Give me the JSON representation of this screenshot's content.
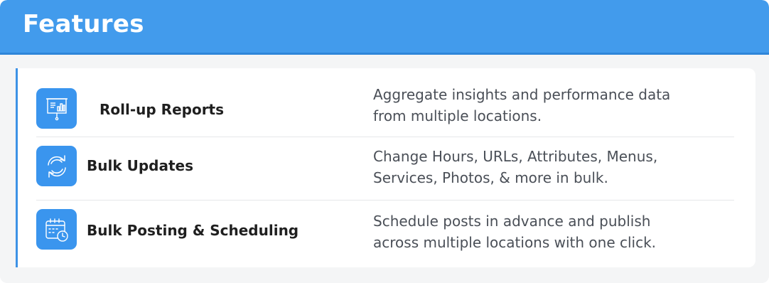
{
  "header": {
    "title": "Features"
  },
  "features": [
    {
      "icon": "presentation-chart-icon",
      "title": "Roll-up Reports",
      "description": [
        "Aggregate insights and performance data",
        "from multiple locations."
      ]
    },
    {
      "icon": "refresh-sync-icon",
      "title": "Bulk Updates",
      "description": [
        "Change Hours, URLs, Attributes, Menus,",
        "Services, Photos, & more in bulk."
      ]
    },
    {
      "icon": "calendar-clock-icon",
      "title": "Bulk Posting & Scheduling",
      "description": [
        "Schedule posts in advance and publish",
        "across multiple locations with one click."
      ]
    }
  ],
  "colors": {
    "header": "#429bec",
    "icon_tile": "#3a95ee",
    "panel": "#f4f5f6"
  }
}
